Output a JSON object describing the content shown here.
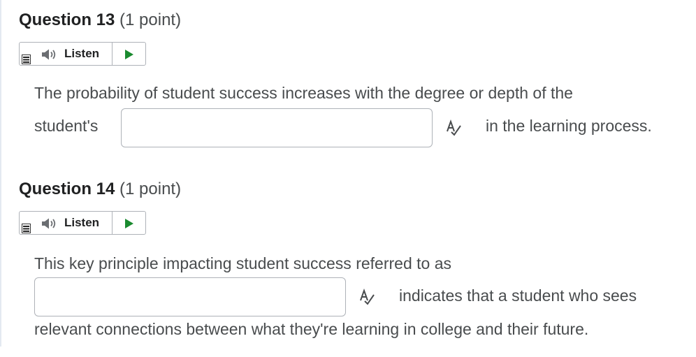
{
  "questions": [
    {
      "title": "Question 13",
      "points": "(1 point)",
      "listen_label": "Listen",
      "prompt_line1": "The probability of student success increases with the degree or depth of the",
      "prompt_before_blank": "student's",
      "answer_value": "",
      "prompt_after_blank": "in the learning process."
    },
    {
      "title": "Question 14",
      "points": "(1 point)",
      "listen_label": "Listen",
      "prompt_line1": "This key principle impacting student success referred to as",
      "answer_value": "",
      "prompt_after_blank": "indicates that a student who sees",
      "prompt_line3": "relevant connections between what they're learning in college and their future."
    }
  ],
  "icons": {
    "menu": "menu-icon",
    "speaker": "speaker-icon",
    "play": "play-icon",
    "spellcheck": "spellcheck-icon"
  },
  "colors": {
    "play_green": "#1a8a2f",
    "border": "#aeb2b8",
    "text": "#494c4e",
    "heading": "#202122"
  }
}
